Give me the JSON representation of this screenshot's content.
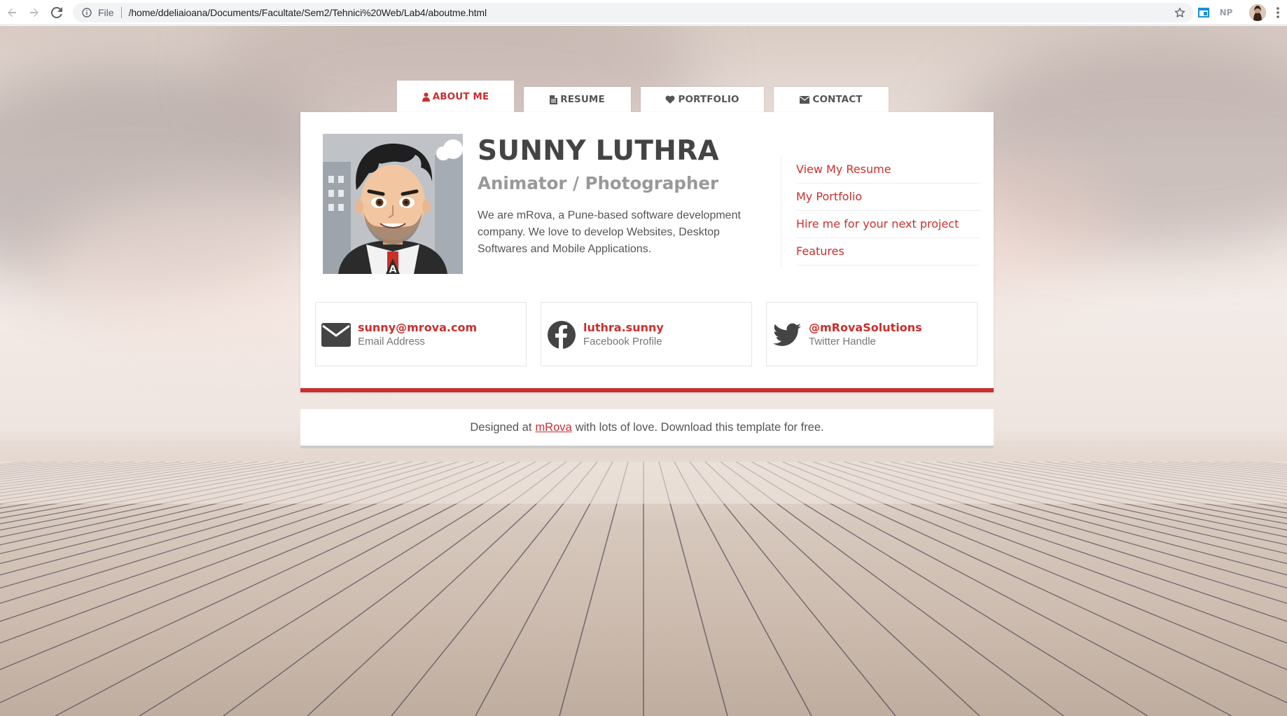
{
  "browser": {
    "scheme": "File",
    "url": "/home/ddeliaioana/Documents/Facultate/Sem2/Tehnici%20Web/Lab4/aboutme.html",
    "extension_np": "NP"
  },
  "tabs": [
    {
      "label": "ABOUT ME",
      "icon": "user-icon",
      "active": true
    },
    {
      "label": "RESUME",
      "icon": "file-icon",
      "active": false
    },
    {
      "label": "PORTFOLIO",
      "icon": "heart-icon",
      "active": false
    },
    {
      "label": "CONTACT",
      "icon": "envelope-icon",
      "active": false
    }
  ],
  "profile": {
    "name": "SUNNY LUTHRA",
    "role": "Animator / Photographer",
    "bio": "We are mRova, a Pune-based software development company. We love to develop Websites, Desktop Softwares and Mobile Applications."
  },
  "quick_links": [
    "View My Resume",
    "My Portfolio",
    "Hire me for your next project",
    "Features"
  ],
  "contacts": [
    {
      "value": "sunny@mrova.com",
      "label": "Email Address",
      "icon": "envelope-icon"
    },
    {
      "value": "luthra.sunny",
      "label": "Facebook Profile",
      "icon": "facebook-icon"
    },
    {
      "value": "@mRovaSolutions",
      "label": "Twitter Handle",
      "icon": "twitter-icon"
    }
  ],
  "footer": {
    "before": "Designed at",
    "brand": "mRova",
    "after": "with lots of love. Download this template for free."
  },
  "colors": {
    "accent": "#c9302c",
    "text": "#444444",
    "muted": "#999999"
  }
}
